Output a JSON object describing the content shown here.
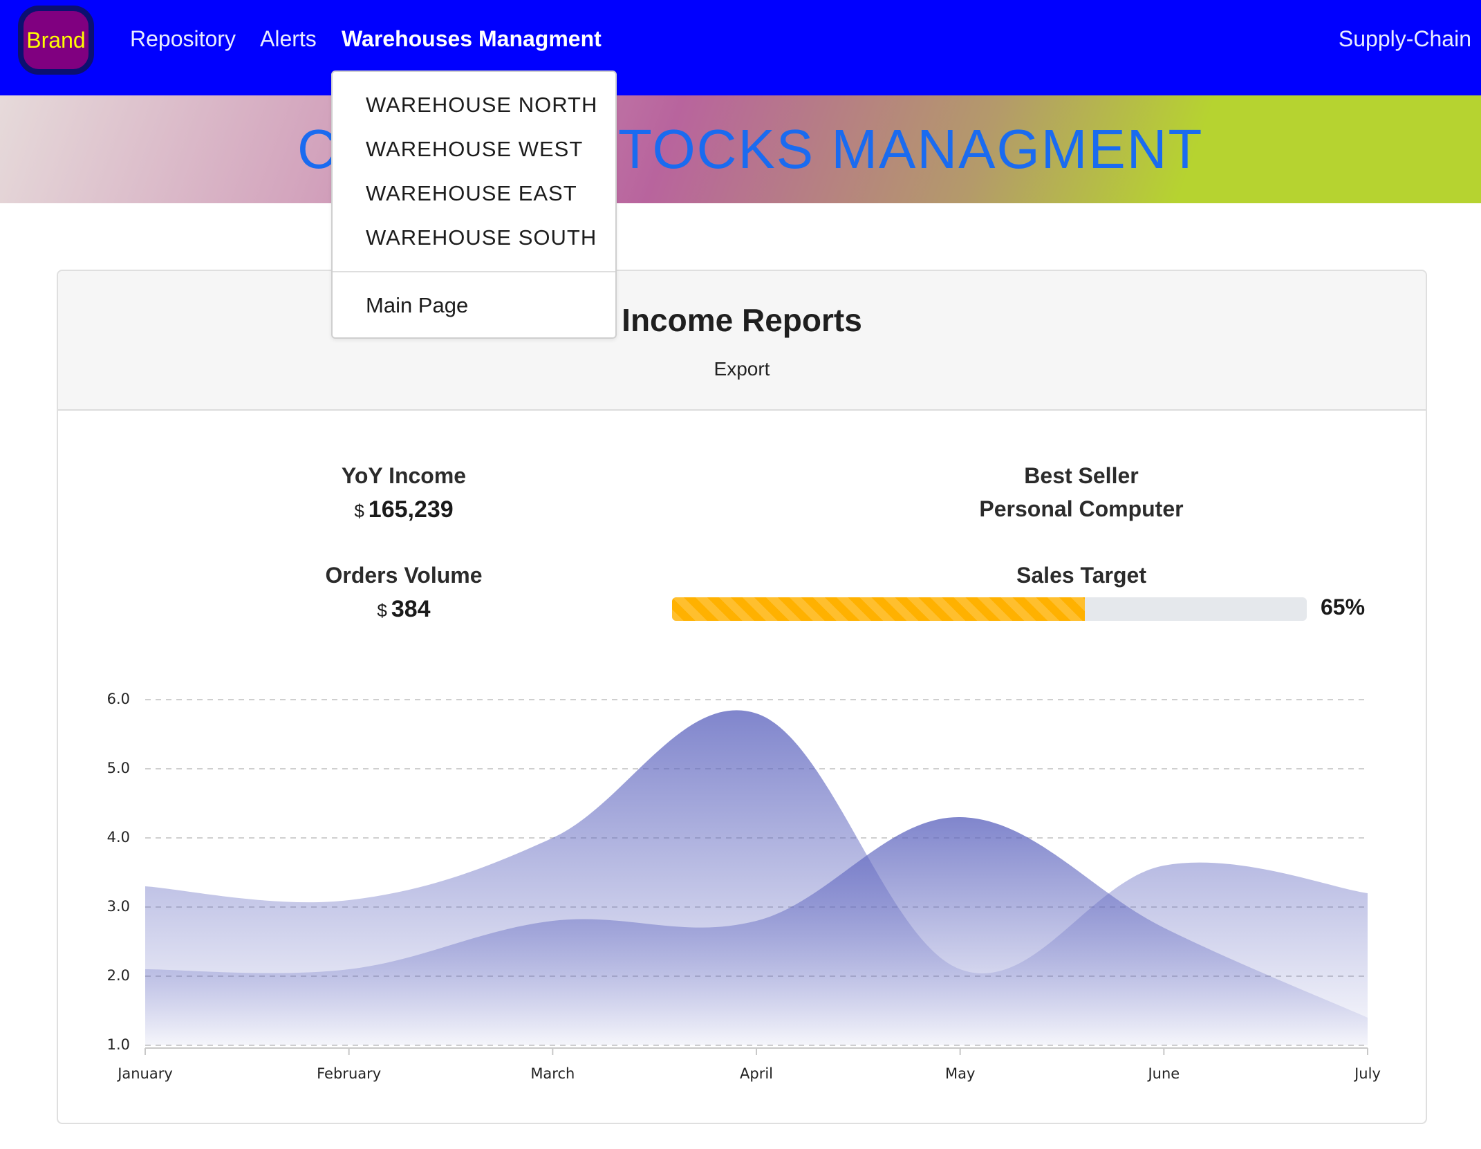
{
  "navbar": {
    "brand": "Brand",
    "links": [
      "Repository",
      "Alerts",
      "Warehouses Managment"
    ],
    "right_label": "Supply-Chain",
    "colors": {
      "background": "#0000ff",
      "brand_bg": "#800080",
      "brand_text": "#ffff00"
    }
  },
  "banner": {
    "title": "CENTRAL STOCKS MANAGMENT",
    "title_color": "#1a6bf0"
  },
  "dropdown": {
    "items": [
      "WAREHOUSE NORTH",
      "WAREHOUSE WEST",
      "WAREHOUSE EAST",
      "WAREHOUSE SOUTH"
    ],
    "footer_item": "Main Page"
  },
  "report": {
    "title": "Income Reports",
    "export_label": "Export",
    "stats": {
      "yoy_label": "YoY Income",
      "yoy_currency": "$",
      "yoy_value": "165,239",
      "best_seller_label": "Best Seller",
      "best_seller_value": "Personal Computer",
      "orders_label": "Orders Volume",
      "orders_currency": "$",
      "orders_value": "384",
      "sales_target_label": "Sales Target",
      "sales_target_percent": 65,
      "sales_target_text": "65%",
      "progress_color": "#ffb100"
    }
  },
  "chart_data": {
    "type": "area",
    "categories": [
      "January",
      "February",
      "March",
      "April",
      "May",
      "June",
      "July"
    ],
    "y_ticks": [
      "1.0",
      "2.0",
      "3.0",
      "4.0",
      "5.0",
      "6.0"
    ],
    "ylim": [
      1.0,
      6.0
    ],
    "grid": true,
    "series": [
      {
        "values": [
          3.3,
          3.1,
          4.0,
          5.8,
          2.1,
          3.6,
          3.2
        ]
      },
      {
        "values": [
          2.1,
          2.1,
          2.8,
          2.8,
          4.3,
          2.7,
          1.4
        ]
      }
    ],
    "fill_color": "#5c63be"
  }
}
